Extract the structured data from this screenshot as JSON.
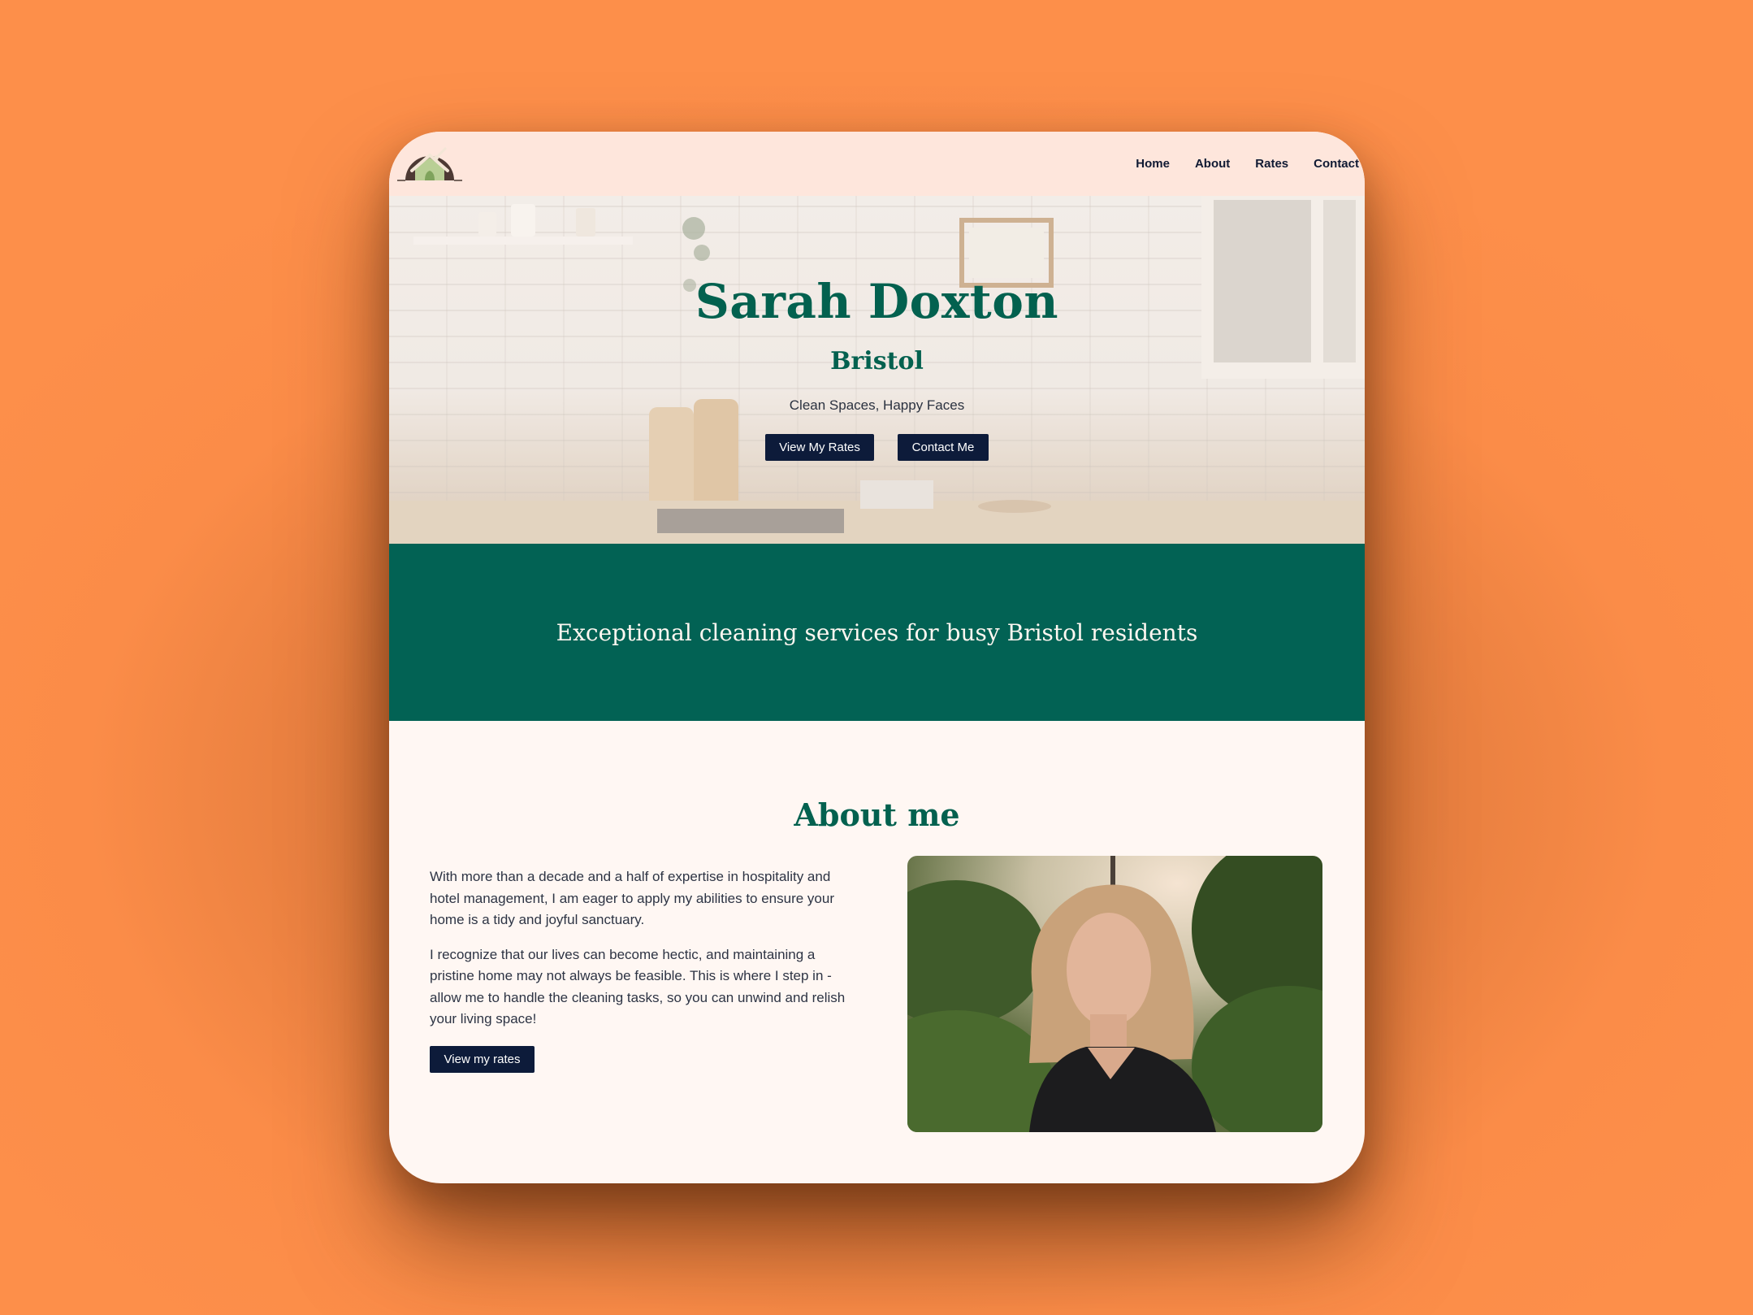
{
  "nav": {
    "items": [
      "Home",
      "About",
      "Rates",
      "Contact"
    ]
  },
  "logo": {
    "icon": "house-broom-logo-icon"
  },
  "hero": {
    "title": "Sarah Doxton",
    "subtitle": "Bristol",
    "tagline": "Clean Spaces, Happy Faces",
    "rates_button": "View My Rates",
    "contact_button": "Contact Me"
  },
  "band": {
    "headline": "Exceptional cleaning services for busy Bristol residents"
  },
  "about": {
    "title": "About me",
    "paragraph_1": "With more than a decade and a half of expertise in hospitality and hotel management, I am eager to apply my abilities to ensure your home is a tidy and joyful sanctuary.",
    "paragraph_2": "I recognize that our lives can become hectic, and maintaining a pristine home may not always be feasible. This is where I step in - allow me to handle the cleaning tasks, so you can unwind and relish your living space!",
    "rates_button": "View my rates"
  },
  "colors": {
    "brand_green": "#03614f",
    "button_navy": "#0d1b3a",
    "header_peach": "#fee6dc",
    "background_orange": "#fd8f4a"
  }
}
